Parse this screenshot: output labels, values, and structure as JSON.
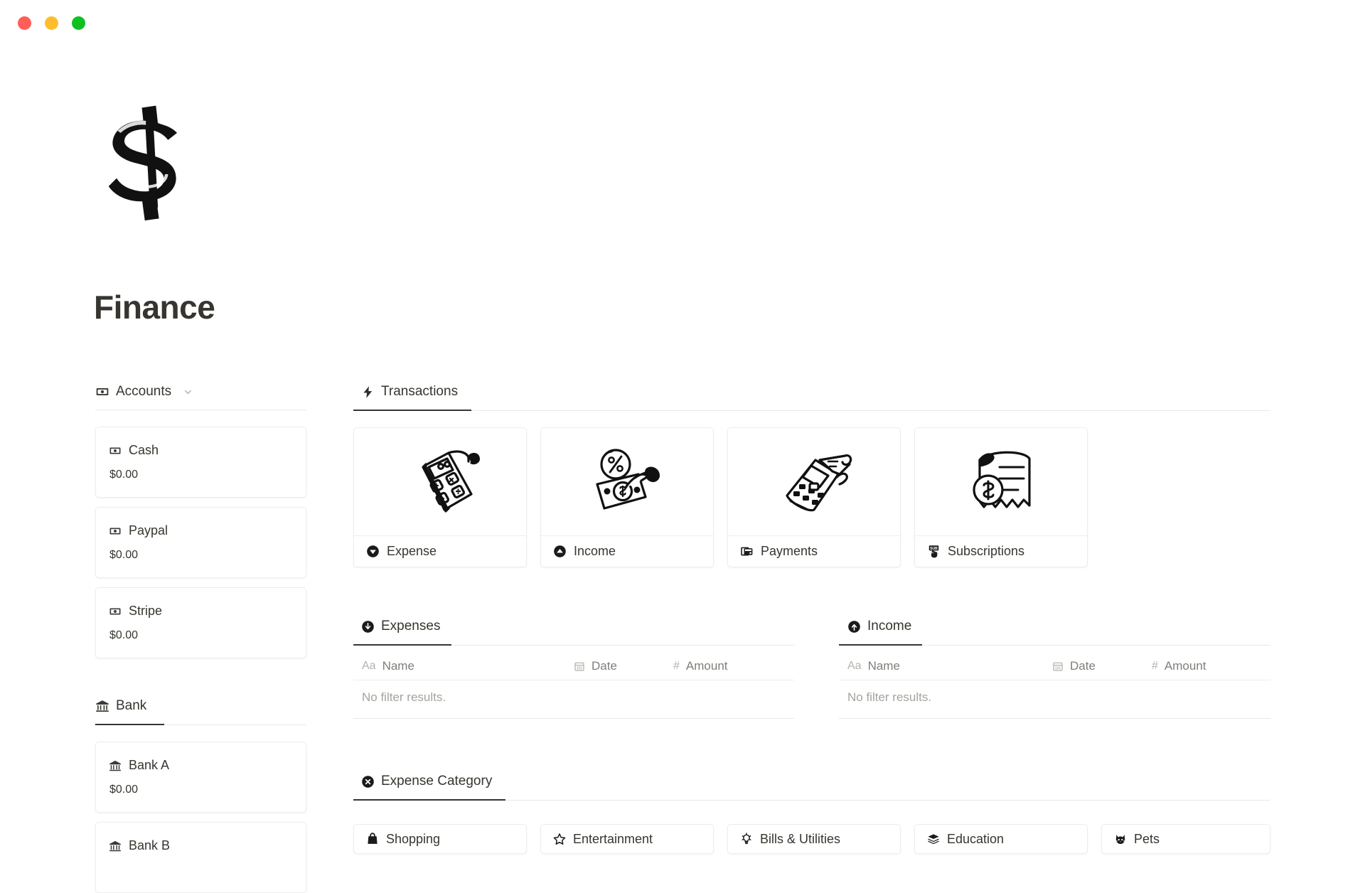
{
  "window": {
    "traffic_lights": [
      {
        "name": "close",
        "color": "#ff5f57"
      },
      {
        "name": "minimize",
        "color": "#ffbd2e"
      },
      {
        "name": "maximize",
        "color": "#0fc023"
      }
    ]
  },
  "page": {
    "title": "Finance",
    "icon": "dollar-sign-doodle"
  },
  "accounts_section": {
    "label": "Accounts",
    "icon": "banknote-icon",
    "chevron": "chevron-down-icon",
    "cards": [
      {
        "name": "Cash",
        "amount": "$0.00",
        "icon": "banknote-icon"
      },
      {
        "name": "Paypal",
        "amount": "$0.00",
        "icon": "banknote-icon"
      },
      {
        "name": "Stripe",
        "amount": "$0.00",
        "icon": "banknote-icon"
      }
    ]
  },
  "bank_section": {
    "label": "Bank",
    "icon": "bank-building-icon",
    "cards": [
      {
        "name": "Bank A",
        "amount": "$0.00",
        "icon": "bank-building-icon"
      },
      {
        "name": "Bank B",
        "amount": "",
        "icon": "bank-building-icon"
      }
    ]
  },
  "transactions_section": {
    "label": "Transactions",
    "icon": "lightning-bolt-icon",
    "tiles": [
      {
        "label": "Expense",
        "icon": "arrow-down-circle-icon",
        "art": "calculator-receipt-art"
      },
      {
        "label": "Income",
        "icon": "arrow-up-circle-icon",
        "art": "money-percent-hand-art"
      },
      {
        "label": "Payments",
        "icon": "credit-cards-icon",
        "art": "card-terminal-art"
      },
      {
        "label": "Subscriptions",
        "icon": "sub-badge-icon",
        "art": "invoice-dollar-art"
      }
    ]
  },
  "expenses_table": {
    "label": "Expenses",
    "icon": "arrow-down-circle-icon",
    "columns": [
      {
        "label": "Name",
        "glyph": "Aa",
        "glyph_name": "text-type-icon"
      },
      {
        "label": "Date",
        "glyph": "calendar",
        "glyph_name": "calendar-icon"
      },
      {
        "label": "Amount",
        "glyph": "#",
        "glyph_name": "number-type-icon"
      }
    ],
    "empty_message": "No filter results."
  },
  "income_table": {
    "label": "Income",
    "icon": "arrow-up-circle-icon",
    "columns": [
      {
        "label": "Name",
        "glyph": "Aa",
        "glyph_name": "text-type-icon"
      },
      {
        "label": "Date",
        "glyph": "calendar",
        "glyph_name": "calendar-icon"
      },
      {
        "label": "Amount",
        "glyph": "#",
        "glyph_name": "number-type-icon"
      }
    ],
    "empty_message": "No filter results."
  },
  "expense_category_section": {
    "label": "Expense Category",
    "icon": "x-circle-icon",
    "chips": [
      {
        "label": "Shopping",
        "icon": "shopping-bag-icon"
      },
      {
        "label": "Entertainment",
        "icon": "star-icon"
      },
      {
        "label": "Bills & Utilities",
        "icon": "lightbulb-icon"
      },
      {
        "label": "Education",
        "icon": "books-icon"
      },
      {
        "label": "Pets",
        "icon": "cat-face-icon"
      }
    ]
  },
  "colors": {
    "text": "#37352f",
    "muted": "#a5a39e",
    "border": "#eeedeb",
    "rule": "#e9e9e7",
    "accent_underline": "#37352f"
  }
}
